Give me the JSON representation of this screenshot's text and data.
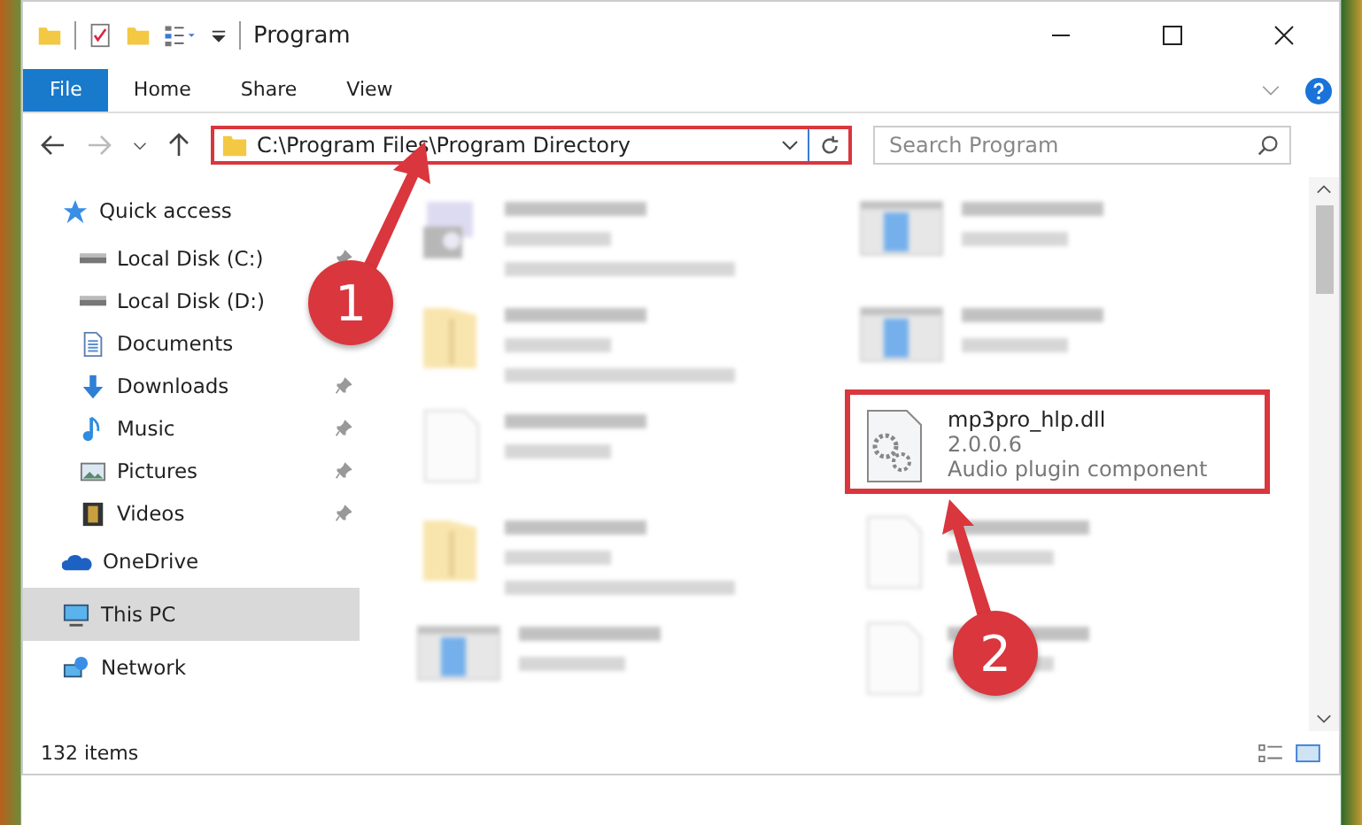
{
  "window": {
    "title": "Program"
  },
  "ribbon_tabs": [
    {
      "label": "File",
      "selected": true
    },
    {
      "label": "Home",
      "selected": false
    },
    {
      "label": "Share",
      "selected": false
    },
    {
      "label": "View",
      "selected": false
    }
  ],
  "address_bar": {
    "path": "C:\\Program Files\\Program Directory"
  },
  "search": {
    "placeholder": "Search Program"
  },
  "sidebar": {
    "items": [
      {
        "label": "Quick access",
        "kind": "star",
        "selected": false,
        "children": [
          {
            "label": "Local Disk (C:)",
            "kind": "drive",
            "pinned": true,
            "selected": false
          },
          {
            "label": "Local Disk (D:)",
            "kind": "drive",
            "pinned": false,
            "selected": false
          },
          {
            "label": "Documents",
            "kind": "document",
            "pinned": false,
            "selected": false
          },
          {
            "label": "Downloads",
            "kind": "download",
            "pinned": true,
            "selected": false
          },
          {
            "label": "Music",
            "kind": "music",
            "pinned": true,
            "selected": false
          },
          {
            "label": "Pictures",
            "kind": "pictures",
            "pinned": true,
            "selected": false
          },
          {
            "label": "Videos",
            "kind": "videos",
            "pinned": true,
            "selected": false
          }
        ]
      },
      {
        "label": "OneDrive",
        "kind": "cloud",
        "selected": false
      },
      {
        "label": "This PC",
        "kind": "pc",
        "selected": true
      },
      {
        "label": "Network",
        "kind": "network",
        "selected": false
      }
    ]
  },
  "files": [
    {
      "kind": "installer",
      "blurred": true
    },
    {
      "kind": "app",
      "blurred": true
    },
    {
      "kind": "folder",
      "blurred": true
    },
    {
      "kind": "app",
      "blurred": true
    },
    {
      "kind": "file",
      "blurred": true
    },
    {
      "name": "mp3pro_hlp.dll",
      "details": [
        "2.0.0.6",
        "Audio plugin component"
      ],
      "kind": "dll",
      "blurred": false
    },
    {
      "kind": "folder",
      "blurred": true
    },
    {
      "kind": "file",
      "blurred": true
    },
    {
      "kind": "app",
      "blurred": true
    },
    {
      "kind": "file",
      "blurred": true
    }
  ],
  "callouts": [
    {
      "number": "1"
    },
    {
      "number": "2"
    }
  ],
  "status_bar": {
    "count": "132 items"
  }
}
